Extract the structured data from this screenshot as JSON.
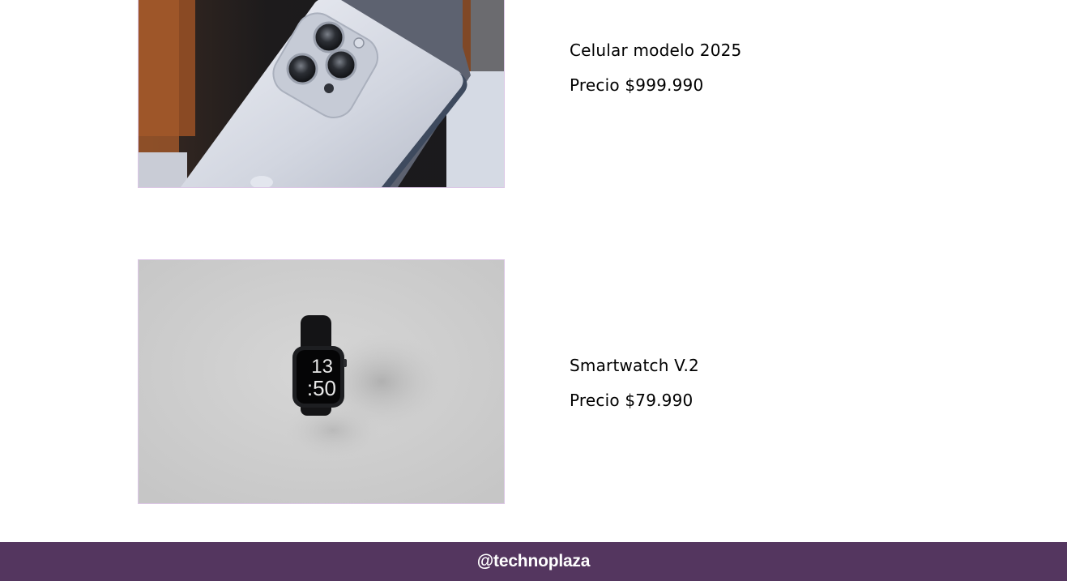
{
  "products": [
    {
      "image_alt": "phone-photo",
      "name": "Celular modelo 2025",
      "price": "Precio $999.990"
    },
    {
      "image_alt": "smartwatch-photo",
      "name": "Smartwatch V.2",
      "price": "Precio $79.990"
    }
  ],
  "watch_face": {
    "hour": "13",
    "minute": ":50"
  },
  "footer": {
    "handle": "@technoplaza"
  },
  "colors": {
    "footer_bg": "#54365f",
    "image_border": "#dcc6e6"
  }
}
